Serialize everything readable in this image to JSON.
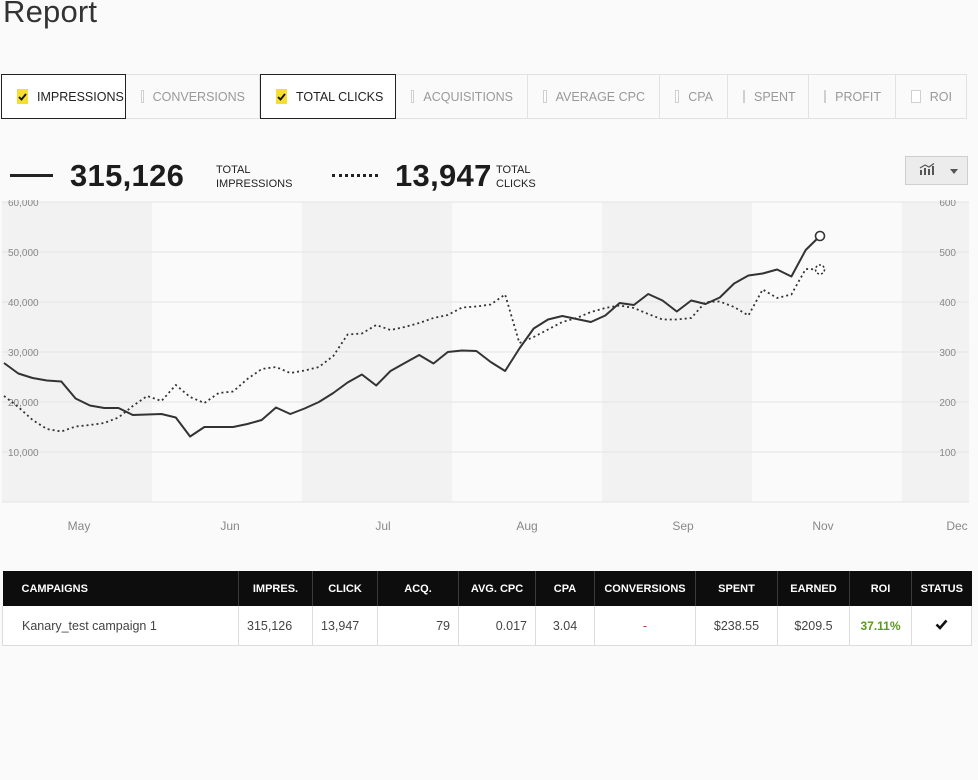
{
  "page": {
    "title": "Report"
  },
  "filters": [
    {
      "label": "IMPRESSIONS",
      "checked": true
    },
    {
      "label": "CONVERSIONS",
      "checked": false
    },
    {
      "label": "TOTAL CLICKS",
      "checked": true
    },
    {
      "label": "ACQUISITIONS",
      "checked": false
    },
    {
      "label": "AVERAGE CPC",
      "checked": false
    },
    {
      "label": "CPA",
      "checked": false
    },
    {
      "label": "SPENT",
      "checked": false
    },
    {
      "label": "PROFIT",
      "checked": false
    },
    {
      "label": "ROI",
      "checked": false
    }
  ],
  "summary": {
    "impressions": {
      "value": "315,126",
      "label_line1": "TOTAL",
      "label_line2": "IMPRESSIONS"
    },
    "clicks": {
      "value": "13,947",
      "label_line1": "TOTAL",
      "label_line2": "CLICKS"
    }
  },
  "chart_toggle": {
    "icon": "bar-line-chart-icon"
  },
  "chart_data": {
    "type": "line",
    "x_ticks": [
      "May",
      "Jun",
      "Jul",
      "Aug",
      "Sep",
      "Nov",
      "Dec"
    ],
    "left_axis": {
      "ticks": [
        "10,000",
        "20,000",
        "30,000",
        "40,000",
        "50,000",
        "60,000"
      ],
      "ylim": [
        0,
        60000
      ]
    },
    "right_axis": {
      "ticks": [
        "100",
        "200",
        "300",
        "400",
        "500",
        "600"
      ],
      "ylim": [
        0,
        600
      ]
    },
    "grid": true,
    "series": [
      {
        "axis": "left",
        "style": "solid",
        "values": [
          27800,
          25700,
          24800,
          24300,
          24100,
          20700,
          19300,
          18800,
          18800,
          17400,
          17500,
          17600,
          16900,
          13100,
          15000,
          15000,
          15000,
          15600,
          16400,
          18900,
          17600,
          18700,
          20000,
          21800,
          23900,
          25500,
          23300,
          26200,
          27800,
          29400,
          27700,
          30000,
          30300,
          30200,
          28000,
          26200,
          30700,
          34700,
          36500,
          37200,
          36600,
          36000,
          37300,
          39800,
          39400,
          41600,
          40300,
          38100,
          40300,
          39600,
          40900,
          43700,
          45300,
          45700,
          46500,
          45100,
          50400,
          53200
        ],
        "end_marker": true
      },
      {
        "axis": "right",
        "style": "dotted",
        "values": [
          212,
          190,
          164,
          146,
          141,
          151,
          154,
          158,
          169,
          192,
          212,
          202,
          234,
          210,
          198,
          218,
          221,
          246,
          266,
          270,
          258,
          263,
          270,
          292,
          335,
          337,
          354,
          344,
          350,
          358,
          368,
          374,
          389,
          391,
          395,
          415,
          318,
          330,
          345,
          360,
          368,
          380,
          388,
          393,
          388,
          376,
          365,
          365,
          368,
          400,
          401,
          390,
          373,
          425,
          408,
          415,
          466,
          465
        ]
      }
    ]
  },
  "table": {
    "headers": [
      "CAMPAIGNS",
      "IMPRES.",
      "CLICK",
      "ACQ.",
      "AVG. CPC",
      "CPA",
      "CONVERSIONS",
      "SPENT",
      "EARNED",
      "ROI",
      "STATUS"
    ],
    "rows": [
      {
        "campaign": "Kanary_test campaign 1",
        "impressions": "315,126",
        "clicks": "13,947",
        "acquisitions": "79",
        "avg_cpc": "0.017",
        "cpa": "3.04",
        "conversions": "-",
        "spent": "$238.55",
        "earned": "$209.5",
        "roi": "37.11%",
        "status_icon": "checkmark-icon"
      }
    ]
  },
  "colors": {
    "accent_yellow": "#f4de2e",
    "roi_green": "#5a9a1d",
    "dash_red": "#c0392b",
    "header_black": "#0d0d0d"
  }
}
